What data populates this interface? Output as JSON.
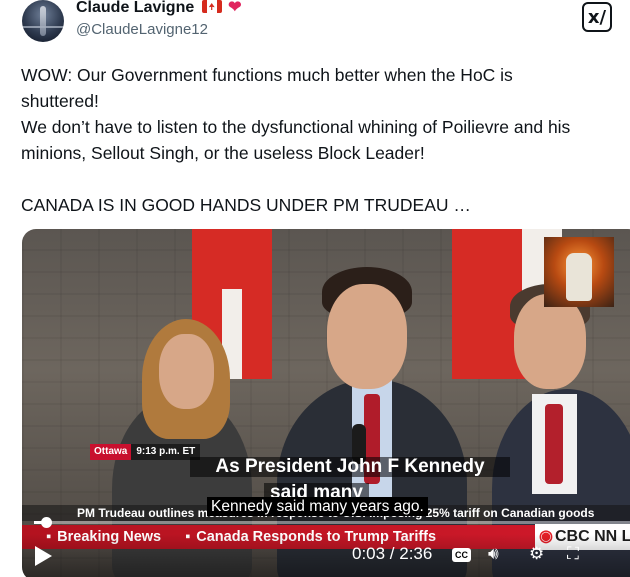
{
  "author": {
    "name": "Claude Lavigne",
    "handle": "@ClaudeLavigne12",
    "badge_heart": "❤"
  },
  "grok_button_label": "x/",
  "tweet": {
    "lines": [
      "WOW: Our Government functions much better when the HoC is",
      "shuttered!",
      "We don’t have to listen to the dysfunctional whining of Poilievre and his",
      "minions, Sellout Singh, or the useless Block Leader!",
      "CANADA IS IN GOOD HANDS UNDER PM TRUDEAU …"
    ]
  },
  "video": {
    "location": "Ottawa",
    "local_time": "9:13 p.m. ET",
    "caption_line1": "As President John F Kennedy",
    "caption_line2": "said many",
    "caption_line3": "Kennedy said many years ago.",
    "headline": "PM Trudeau outlines measures in response to U.S. imposing 25% tariff on Canadian goods",
    "ticker_items": [
      "Breaking News",
      "Canada Responds to Trump Tariffs"
    ],
    "network": "CBC NN L",
    "current_time": "0:03",
    "duration": "2:36",
    "time_display": "0:03 / 2:36",
    "progress_fraction": 0.02,
    "controls": {
      "play_icon": "play-icon",
      "cc_label": "CC",
      "volume_icon": "volume-icon",
      "settings_icon": "settings-icon",
      "fullscreen_icon": "fullscreen-icon"
    }
  }
}
